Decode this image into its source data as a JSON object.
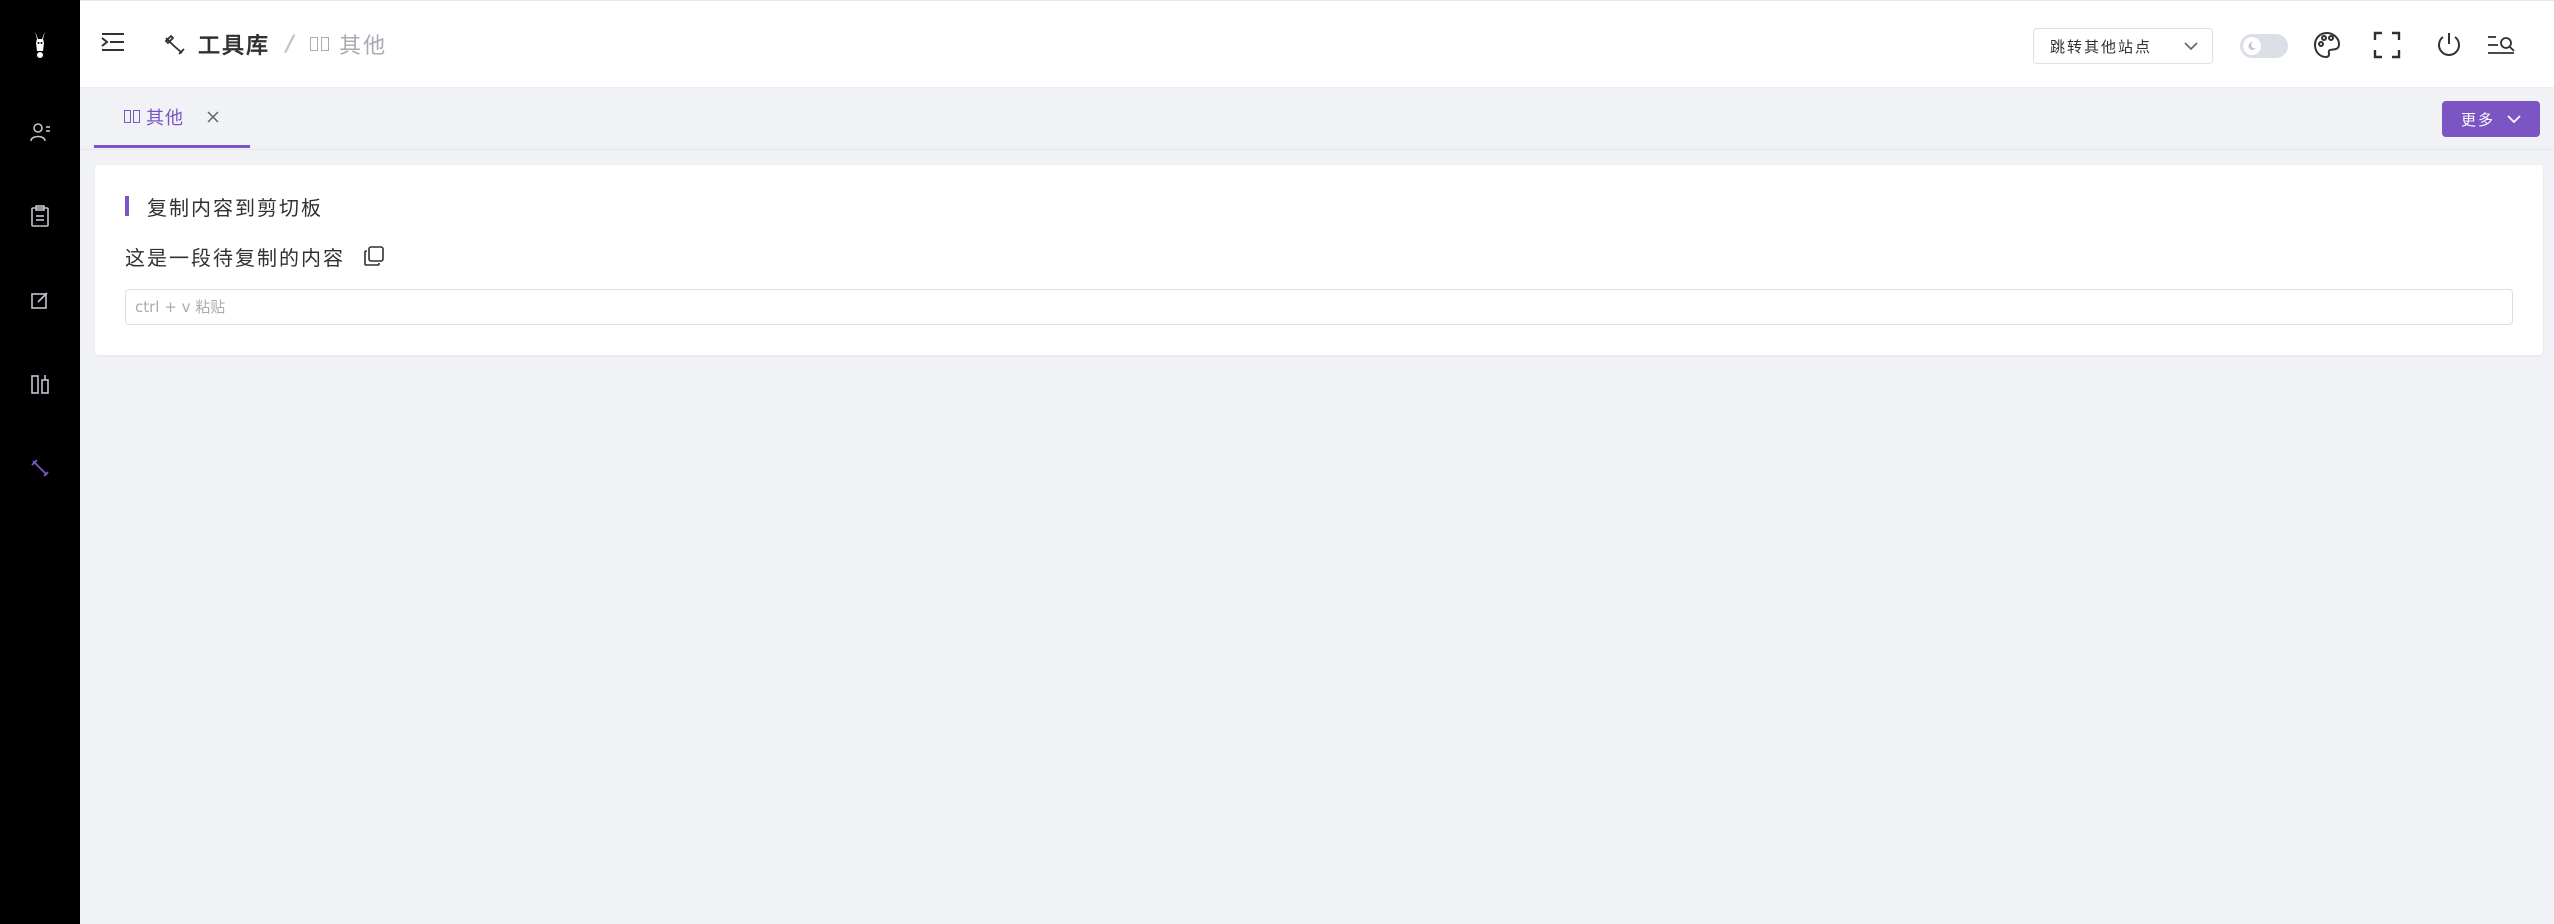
{
  "colors": {
    "accent": "#7c55c4",
    "sidebar_bg": "#000000",
    "page_bg": "#f0f2f5"
  },
  "sidebar": {
    "logo_icon": "donkey-logo",
    "items": [
      {
        "icon": "users-icon"
      },
      {
        "icon": "clipboard-icon"
      },
      {
        "icon": "edit-icon"
      },
      {
        "icon": "tools-box-icon"
      },
      {
        "icon": "wrench-icon",
        "active": true
      }
    ]
  },
  "header": {
    "breadcrumb": {
      "first": "工具库",
      "separator": "/",
      "second": "其他"
    },
    "site_select": {
      "value": "跳转其他站点"
    }
  },
  "tabs": {
    "items": [
      {
        "label": "其他"
      }
    ],
    "more_label": "更多"
  },
  "card": {
    "title": "复制内容到剪切板",
    "copy_text": "这是一段待复制的内容",
    "paste_placeholder": "ctrl + v 粘贴"
  }
}
